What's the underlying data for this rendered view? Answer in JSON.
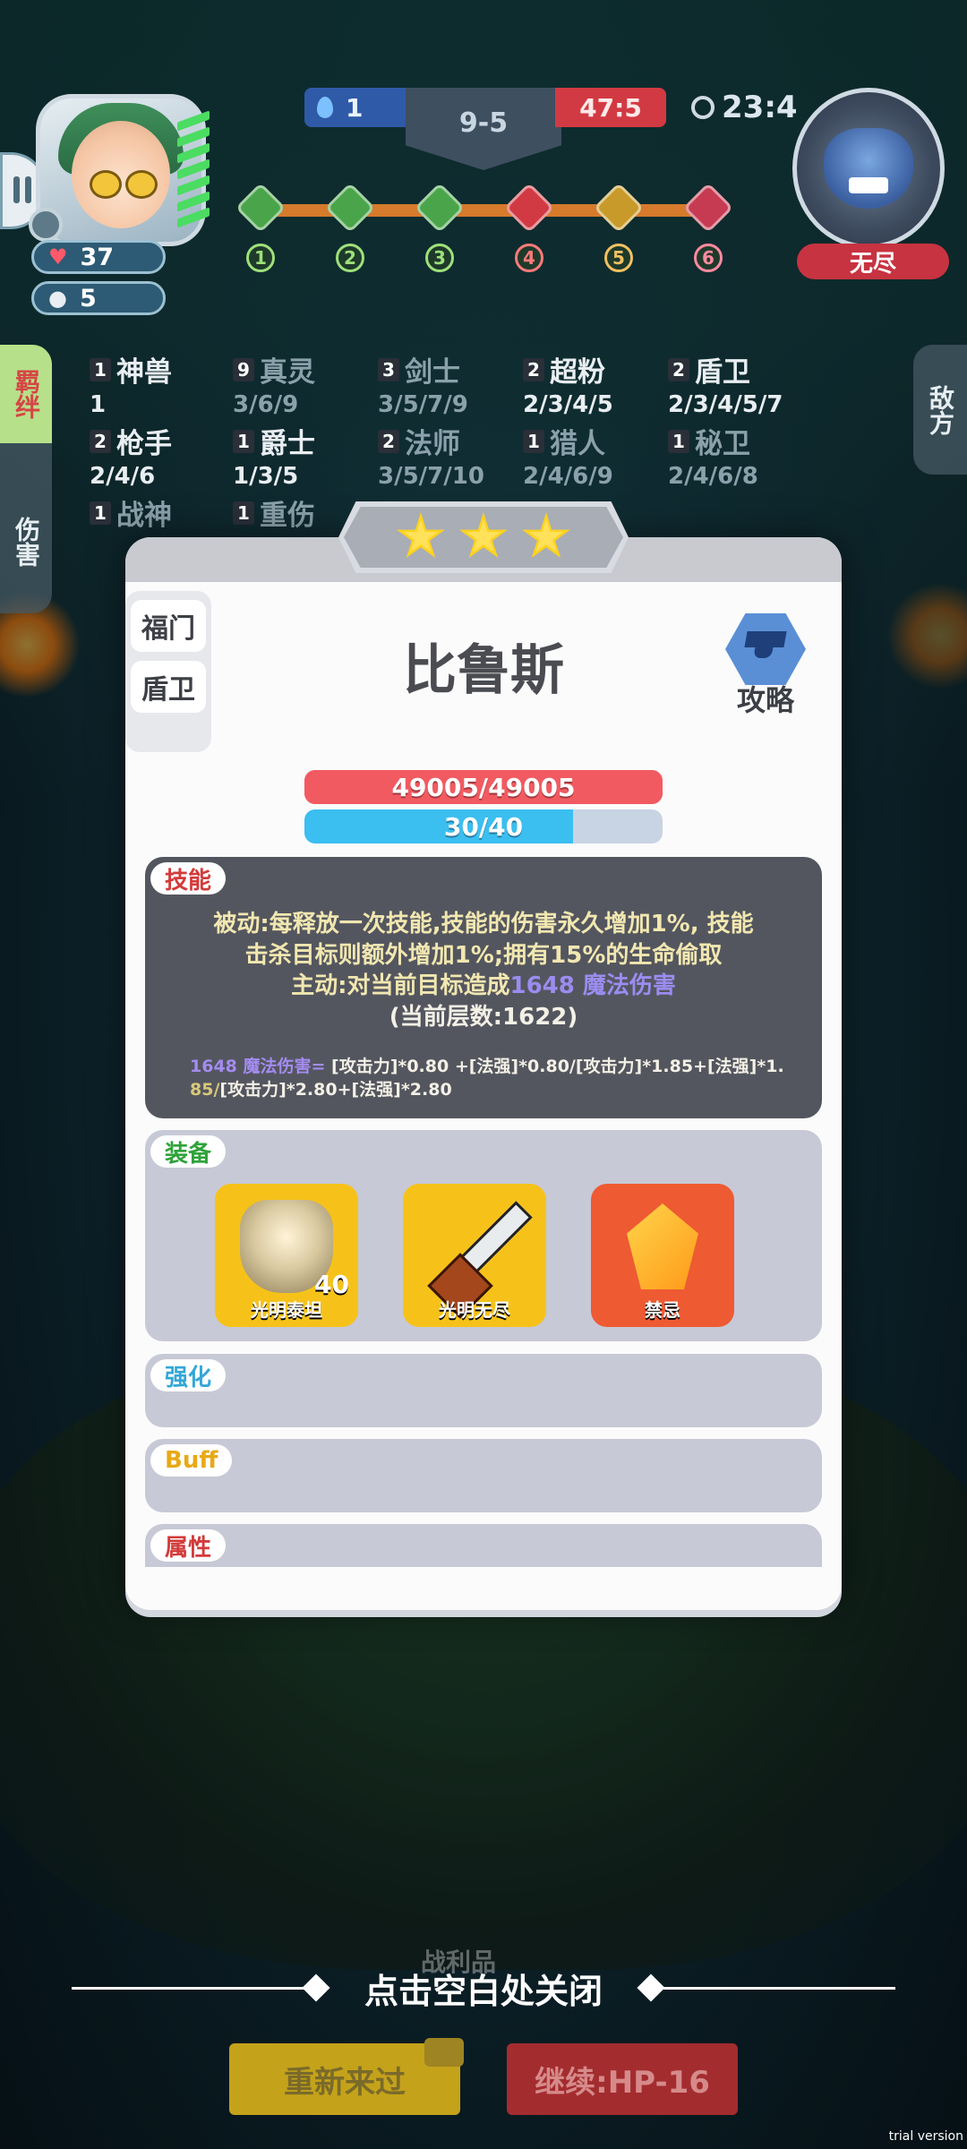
{
  "hud": {
    "hearts": "37",
    "coins": "5",
    "blue_score": "1",
    "stage": "9-5",
    "red_score": "47:5",
    "timer": "23:4",
    "enemy_tag": "无尽",
    "stages": [
      "1",
      "2",
      "3",
      "4",
      "5",
      "6"
    ]
  },
  "side_tabs": {
    "synergy": "羁绊",
    "damage": "伤害",
    "enemy": "敌方"
  },
  "synergies": [
    {
      "count": "1",
      "name": "神兽",
      "tiers": "1"
    },
    {
      "count": "9",
      "name": "真灵",
      "tiers": "3/6/9"
    },
    {
      "count": "3",
      "name": "剑士",
      "tiers": "3/5/7/9"
    },
    {
      "count": "2",
      "name": "超粉",
      "tiers": "2/3/4/5"
    },
    {
      "count": "2",
      "name": "盾卫",
      "tiers": "2/3/4/5/7"
    },
    {
      "count": "2",
      "name": "枪手",
      "tiers": "2/4/6"
    },
    {
      "count": "1",
      "name": "爵士",
      "tiers": "1/3/5"
    },
    {
      "count": "2",
      "name": "法师",
      "tiers": "3/5/7/10"
    },
    {
      "count": "1",
      "name": "猎人",
      "tiers": "2/4/6/9"
    },
    {
      "count": "1",
      "name": "秘卫",
      "tiers": "2/4/6/8"
    },
    {
      "count": "1",
      "name": "战神",
      "tiers": ""
    },
    {
      "count": "1",
      "name": "重伤",
      "tiers": ""
    }
  ],
  "panel": {
    "stars": 3,
    "traits": [
      "福门",
      "盾卫"
    ],
    "hero_name": "比鲁斯",
    "guide_label": "攻略",
    "hp_text": "49005/49005",
    "hp_fraction": 1.0,
    "mp_text": "30/40",
    "mp_fraction": 0.75,
    "skill": {
      "title": "技能",
      "line1": "被动:每释放一次技能,技能的伤害永久增加1%, 技能",
      "line2": "击杀目标则额外增加1%;拥有15%的生命偷取",
      "line3_pre": "主动:对当前目标造成",
      "line3_hl": "1648 魔法伤害",
      "line4": "(当前层数:1622)",
      "formula_p": "1648 魔法伤害=",
      "formula_a": " [攻击力]*0.80 +[法强]*0.80/[攻击力]*1.85+[法强]*1.",
      "formula_y": "85/",
      "formula_b": "[攻击力]*2.80+[法强]*2.80"
    },
    "equipment": {
      "title": "装备",
      "items": [
        {
          "name": "光明泰坦",
          "level": "40"
        },
        {
          "name": "光明无尽",
          "level": ""
        },
        {
          "name": "禁忌",
          "level": ""
        }
      ]
    },
    "enhance_title": "强化",
    "buff_title": "Buff",
    "attr_title": "属性"
  },
  "bottom": {
    "close_hint": "点击空白处关闭",
    "loot_label": "战利品",
    "retry": "重新来过",
    "continue": "继续:HP-16",
    "trial": "trial version"
  },
  "colors": {
    "hp": "#f25a61",
    "mp": "#3bbef0",
    "skill_panel": "#54565f",
    "section_bg": "#c7c9d6",
    "star": "#ffd21e"
  }
}
